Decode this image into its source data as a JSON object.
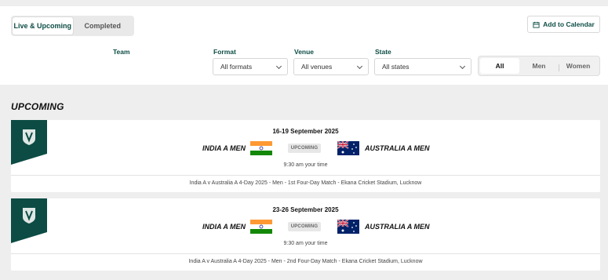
{
  "tabs": [
    {
      "label": "Live & Upcoming",
      "active": true
    },
    {
      "label": "Completed",
      "active": false
    }
  ],
  "calendar_button": {
    "label": "Add to Calendar",
    "icon": "calendar-icon"
  },
  "filters": {
    "team_label": "Team",
    "format": {
      "label": "Format",
      "value": "All formats"
    },
    "venue": {
      "label": "Venue",
      "value": "All venues"
    },
    "state": {
      "label": "State",
      "value": "All states"
    },
    "gender": [
      "All",
      "Men",
      "Women"
    ],
    "gender_active": "All"
  },
  "section_title": "UPCOMING",
  "matches": [
    {
      "date": "16-19 September 2025",
      "home": "INDIA A MEN",
      "away": "AUSTRALIA A MEN",
      "status": "UPCOMING",
      "time": "9:30 am your time",
      "description": "India A v Australia A 4-Day 2025 - Men - 1st Four-Day Match - Ekana Cricket Stadium, Lucknow"
    },
    {
      "date": "23-26 September 2025",
      "home": "INDIA A MEN",
      "away": "AUSTRALIA A MEN",
      "status": "UPCOMING",
      "time": "9:30 am your time",
      "description": "India A v Australia A 4-Day 2025 - Men - 2nd Four-Day Match - Ekana Cricket Stadium, Lucknow"
    }
  ],
  "colors": {
    "brand": "#0c4c44",
    "background": "#eeeeee"
  }
}
